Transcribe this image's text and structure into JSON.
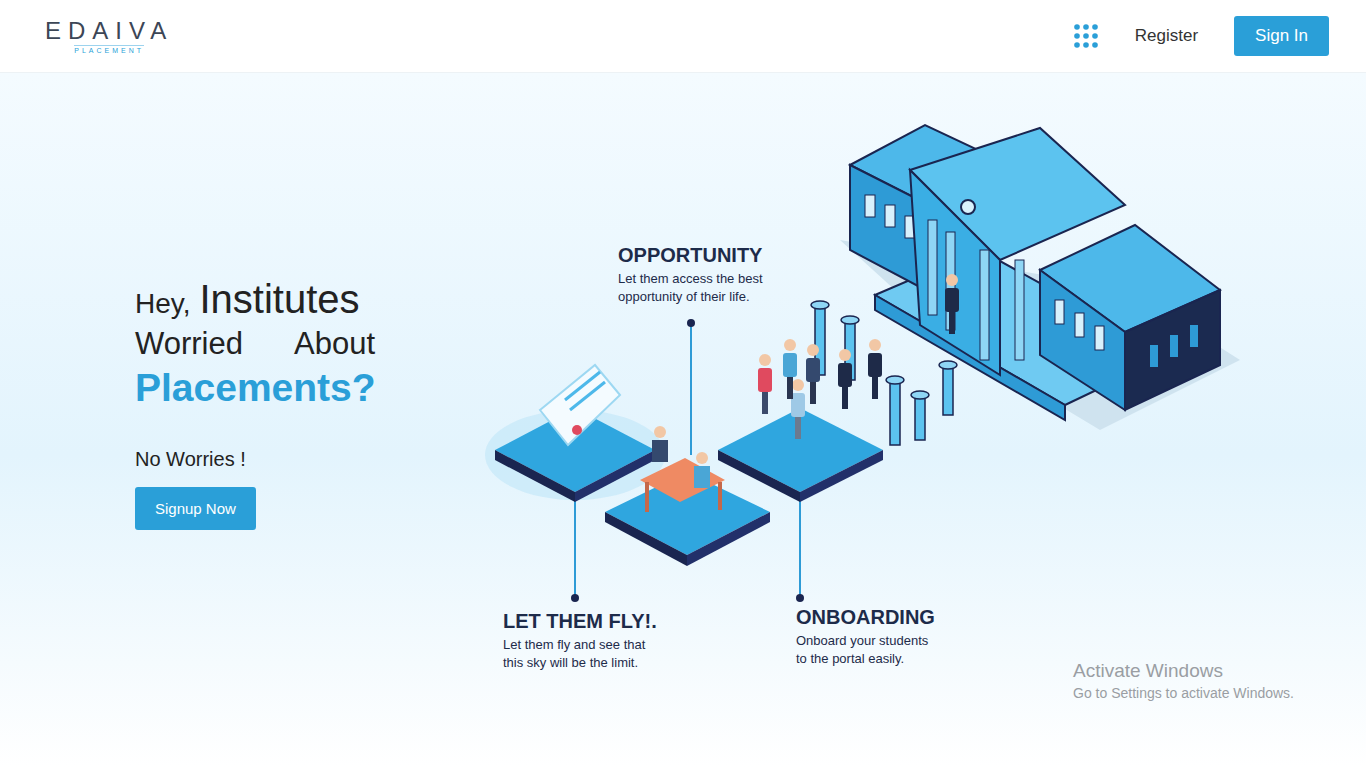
{
  "header": {
    "logo": {
      "name": "EDAIVA",
      "tagline": "PLACEMENT"
    },
    "nav": [
      {
        "label": "Register",
        "kind": "link"
      },
      {
        "label": "Sign In",
        "kind": "button"
      }
    ]
  },
  "hero": {
    "greeting": "Hey,",
    "audience": "Institutes",
    "line2": [
      "Worried",
      "About"
    ],
    "headline": "Placements?",
    "subtext": "No Worries !",
    "cta": "Signup Now"
  },
  "features": [
    {
      "title": "OPPORTUNITY",
      "lines": [
        "Let them access the best",
        "opportunity of their life."
      ]
    },
    {
      "title": "LET THEM FLY!.",
      "lines": [
        "Let them fly and see that",
        "this sky will be the limit."
      ]
    },
    {
      "title": "ONBOARDING",
      "lines": [
        "Onboard your students",
        "to the portal easily."
      ]
    }
  ],
  "watermark": {
    "title": "Activate Windows",
    "subtitle": "Go to Settings to activate Windows."
  }
}
